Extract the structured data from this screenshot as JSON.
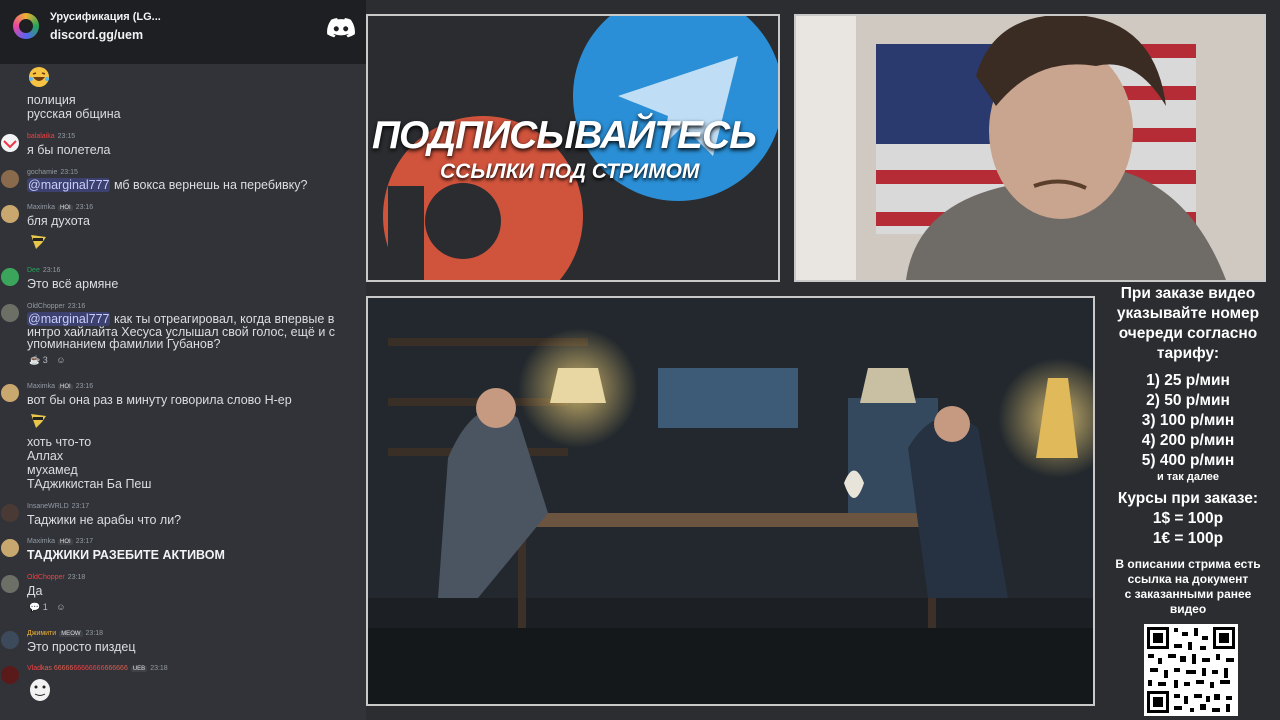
{
  "server": {
    "name": "Урусификация (LG...",
    "invite": "discord.gg/uem"
  },
  "icons": {
    "discord": "discord-logo-icon",
    "reaction_emoji": "emoji-icon",
    "add_reaction": "add-reaction-icon"
  },
  "colors": {
    "chat_bg": "#313338",
    "mention": "#5865f2",
    "red_name": "#f23f43",
    "green_name": "#23a559"
  },
  "chat": {
    "m0": {
      "lines": [
        "полиция",
        "русская община"
      ]
    },
    "m1": {
      "name": "balalaika",
      "time": "23:15",
      "text": "я бы полетела"
    },
    "m2": {
      "name": "gochamie",
      "time": "23:15",
      "mention": "@marginal777",
      "text": " мб вокса вернешь на перебивку?"
    },
    "m3": {
      "name": "Maximka",
      "badge": "HOI",
      "time": "23:16",
      "text": "бля духота"
    },
    "m4": {
      "name": "Dee",
      "time": "23:16",
      "text": "Это всё армяне"
    },
    "m5": {
      "name": "OldChopper",
      "time": "23:16",
      "mention": "@marginal777",
      "line1": " как ты отреагировал, когда впервые в",
      "line2": "интро хайлайта Хесуса услышал свой голос, ещё и с",
      "line3": "упоминанием фамилии Губанов?",
      "reaction_count": "3"
    },
    "m6": {
      "name": "Maximka",
      "badge": "HOI",
      "time": "23:16",
      "text": "вот бы она раз в минуту говорила слово Н-ер",
      "lines": [
        "хоть что-то",
        "Аллах",
        "мухамед",
        "ТАджикистан Ба Пеш"
      ]
    },
    "m7": {
      "name": "InsaneWRLD",
      "time": "23:17",
      "text": "Таджики не арабы что ли?"
    },
    "m8": {
      "name": "Maximka",
      "badge": "HOI",
      "time": "23:17",
      "text": "ТАДЖИКИ РАЗЕБИТЕ АКТИВОМ"
    },
    "m9": {
      "name": "OldChopper",
      "time": "23:18",
      "text": "Да",
      "reaction_count": "1"
    },
    "m10": {
      "name": "Джимити",
      "badge": "MEOW",
      "time": "23:18",
      "text": "Это просто пиздец"
    },
    "m11": {
      "name": "Vlad",
      "name2": "kas 66666",
      "name3": "66666666",
      "name4": "666666",
      "badge": "UEB",
      "time": "23:18"
    }
  },
  "promo": {
    "title": "ПОДПИСЫВАЙТЕСЬ",
    "subtitle": "ССЫЛКИ ПОД СТРИМОМ"
  },
  "sidebar": {
    "intro": [
      "При заказе видео",
      "указывайте номер",
      "очереди согласно",
      "тарифу:"
    ],
    "tariffs": [
      "1) 25 р/мин",
      "2) 50 р/мин",
      "3) 100 р/мин",
      "4) 200 р/мин",
      "5) 400 р/мин"
    ],
    "more": "и так далее",
    "rates_title": "Курсы при заказе:",
    "rates": [
      "1$ = 100р",
      "1€ = 100р"
    ],
    "note": [
      "В описании стрима есть",
      "ссылка на документ",
      "с заказанными ранее",
      "видео"
    ]
  }
}
